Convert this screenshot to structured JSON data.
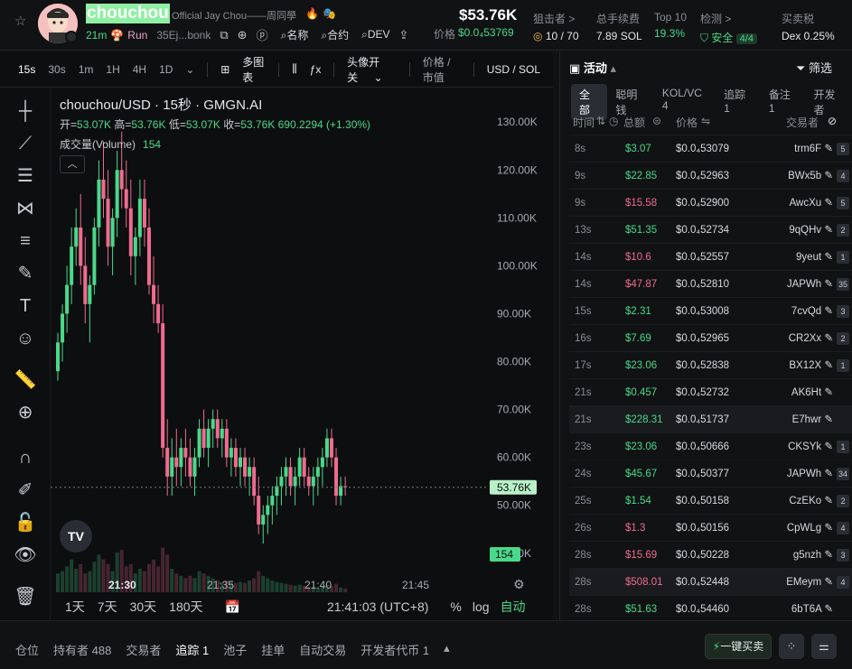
{
  "header": {
    "token_name": "chouchou",
    "token_subtitle": "Official Jay Chou——周同學",
    "age": "21m",
    "run_label": "Run",
    "address": "35Ej...bonk",
    "links": [
      "名称",
      "合约",
      "DEV"
    ],
    "price_big": "$53.76K",
    "price_label": "价格",
    "price_value": "$0.0₄53769",
    "stats": [
      {
        "key": "狙击者 >",
        "value": "10 / 70"
      },
      {
        "key": "总手续费",
        "value": "7.89 SOL"
      },
      {
        "key": "Top 10",
        "value": "19.3%"
      },
      {
        "key": "检测 >",
        "value": "安全",
        "badge": "4/4"
      },
      {
        "key": "买卖税",
        "value": "Dex 0.25%"
      }
    ]
  },
  "toolbar": {
    "intervals": [
      "15s",
      "30s",
      "1m",
      "1H",
      "4H",
      "1D"
    ],
    "multi_chart": "多图表",
    "avatar_toggle": "头像开关",
    "price_mode": "价格 / 市值",
    "currency": "USD / SOL"
  },
  "chart_info": {
    "title": "chouchou/USD · 15秒 · GMGN.AI",
    "open_label": "开=",
    "open": "53.07K",
    "high_label": "高=",
    "high": "53.76K",
    "low_label": "低=",
    "low": "53.07K",
    "close_label": "收=",
    "close": "53.76K",
    "change": "690.2294 (+1.30%)",
    "volume_label": "成交量(Volume)",
    "volume": "154",
    "last_price_tag": "53.76K",
    "volume_tag": "154",
    "tv_logo": "TV"
  },
  "chart_data": {
    "type": "candlestick",
    "y_ticks": [
      "130.00K",
      "120.00K",
      "110.00K",
      "100.00K",
      "90.00K",
      "80.00K",
      "70.00K",
      "60.00K",
      "50.00K",
      "40.00K"
    ],
    "x_ticks": [
      "21:30",
      "21:35",
      "21:40",
      "21:45"
    ],
    "ylim": [
      36000,
      134000
    ],
    "last_price": 53760,
    "candles": [
      [
        78,
        86,
        76,
        84,
        40
      ],
      [
        84,
        92,
        80,
        90,
        45
      ],
      [
        90,
        100,
        86,
        96,
        55
      ],
      [
        96,
        108,
        92,
        104,
        70
      ],
      [
        104,
        112,
        100,
        108,
        50
      ],
      [
        108,
        115,
        96,
        100,
        60
      ],
      [
        100,
        106,
        88,
        92,
        40
      ],
      [
        92,
        98,
        84,
        96,
        45
      ],
      [
        96,
        110,
        94,
        108,
        65
      ],
      [
        108,
        122,
        104,
        118,
        80
      ],
      [
        118,
        126,
        110,
        114,
        70
      ],
      [
        114,
        120,
        100,
        104,
        60
      ],
      [
        104,
        112,
        98,
        110,
        45
      ],
      [
        110,
        124,
        106,
        120,
        85
      ],
      [
        120,
        128,
        112,
        116,
        90
      ],
      [
        116,
        122,
        108,
        112,
        55
      ],
      [
        112,
        118,
        98,
        102,
        60
      ],
      [
        102,
        108,
        96,
        106,
        40
      ],
      [
        106,
        118,
        102,
        114,
        50
      ],
      [
        114,
        118,
        104,
        108,
        45
      ],
      [
        108,
        112,
        94,
        96,
        60
      ],
      [
        96,
        102,
        88,
        92,
        70
      ],
      [
        92,
        96,
        86,
        88,
        55
      ],
      [
        88,
        92,
        60,
        62,
        95
      ],
      [
        62,
        68,
        52,
        56,
        80
      ],
      [
        56,
        64,
        52,
        60,
        50
      ],
      [
        60,
        66,
        54,
        58,
        40
      ],
      [
        58,
        64,
        54,
        62,
        35
      ],
      [
        62,
        66,
        56,
        60,
        30
      ],
      [
        60,
        64,
        54,
        56,
        35
      ],
      [
        56,
        62,
        52,
        60,
        30
      ],
      [
        60,
        68,
        58,
        66,
        45
      ],
      [
        66,
        70,
        60,
        62,
        40
      ],
      [
        62,
        68,
        58,
        66,
        35
      ],
      [
        66,
        70,
        62,
        68,
        30
      ],
      [
        68,
        70,
        62,
        64,
        25
      ],
      [
        64,
        68,
        60,
        66,
        20
      ],
      [
        66,
        68,
        58,
        60,
        25
      ],
      [
        60,
        64,
        56,
        62,
        22
      ],
      [
        62,
        64,
        56,
        58,
        20
      ],
      [
        58,
        62,
        54,
        60,
        22
      ],
      [
        60,
        62,
        54,
        56,
        20
      ],
      [
        56,
        60,
        52,
        58,
        25
      ],
      [
        58,
        60,
        50,
        52,
        30
      ],
      [
        52,
        56,
        44,
        46,
        45
      ],
      [
        46,
        50,
        42,
        48,
        35
      ],
      [
        48,
        52,
        44,
        50,
        30
      ],
      [
        50,
        54,
        46,
        52,
        25
      ],
      [
        52,
        56,
        48,
        54,
        22
      ],
      [
        54,
        58,
        50,
        56,
        20
      ],
      [
        56,
        60,
        52,
        58,
        18
      ],
      [
        58,
        60,
        52,
        54,
        16
      ],
      [
        54,
        58,
        50,
        56,
        14
      ],
      [
        56,
        62,
        54,
        60,
        16
      ],
      [
        60,
        62,
        54,
        56,
        14
      ],
      [
        56,
        58,
        52,
        54,
        12
      ],
      [
        54,
        58,
        50,
        56,
        12
      ],
      [
        56,
        60,
        52,
        58,
        10
      ],
      [
        58,
        62,
        54,
        60,
        12
      ],
      [
        60,
        66,
        58,
        64,
        16
      ],
      [
        64,
        66,
        58,
        60,
        14
      ],
      [
        60,
        62,
        50,
        52,
        18
      ],
      [
        52,
        56,
        50,
        54,
        10
      ],
      [
        54,
        56,
        52,
        53.8,
        8
      ]
    ],
    "grid": false
  },
  "chart_bottom": {
    "ranges": [
      "1天",
      "7天",
      "30天",
      "180天"
    ],
    "time": "21:41:03 (UTC+8)",
    "pct": "%",
    "log": "log",
    "auto": "自动"
  },
  "activity": {
    "title": "活动",
    "filter": "筛选",
    "tabs": [
      "全部",
      "聪明钱",
      "KOL/VC 4",
      "追踪 1",
      "备注 1",
      "开发者"
    ],
    "columns": [
      "时间",
      "总额",
      "价格",
      "交易者"
    ],
    "rows": [
      {
        "age": "8s",
        "total": "$3.07",
        "side": "buy",
        "price": "$0.0₄53079",
        "trader": "trm6F",
        "count": "5"
      },
      {
        "age": "9s",
        "total": "$22.85",
        "side": "buy",
        "price": "$0.0₄52963",
        "trader": "BWx5b",
        "count": "4"
      },
      {
        "age": "9s",
        "total": "$15.58",
        "side": "sell",
        "price": "$0.0₄52900",
        "trader": "AwcXu",
        "count": "5"
      },
      {
        "age": "13s",
        "total": "$51.35",
        "side": "buy",
        "price": "$0.0₄52734",
        "trader": "9qQHv",
        "count": "2"
      },
      {
        "age": "14s",
        "total": "$10.6",
        "side": "sell",
        "price": "$0.0₄52557",
        "trader": "9yeut",
        "count": "1"
      },
      {
        "age": "14s",
        "total": "$47.87",
        "side": "sell",
        "price": "$0.0₄52810",
        "trader": "JAPWh",
        "count": "35"
      },
      {
        "age": "15s",
        "total": "$2.31",
        "side": "buy",
        "price": "$0.0₄53008",
        "trader": "7cvQd",
        "count": "3"
      },
      {
        "age": "16s",
        "total": "$7.69",
        "side": "buy",
        "price": "$0.0₄52965",
        "trader": "CR2Xx",
        "count": "2"
      },
      {
        "age": "17s",
        "total": "$23.06",
        "side": "buy",
        "price": "$0.0₄52838",
        "trader": "BX12X",
        "count": "1"
      },
      {
        "age": "21s",
        "total": "$0.457",
        "side": "buy",
        "price": "$0.0₄52732",
        "trader": "AK6Ht",
        "count": ""
      },
      {
        "age": "21s",
        "total": "$228.31",
        "side": "buy",
        "price": "$0.0₄51737",
        "trader": "E7hwr",
        "count": ""
      },
      {
        "age": "23s",
        "total": "$23.06",
        "side": "buy",
        "price": "$0.0₄50666",
        "trader": "CKSYk",
        "count": "1"
      },
      {
        "age": "24s",
        "total": "$45.67",
        "side": "buy",
        "price": "$0.0₄50377",
        "trader": "JAPWh",
        "count": "34"
      },
      {
        "age": "25s",
        "total": "$1.54",
        "side": "buy",
        "price": "$0.0₄50158",
        "trader": "CzEKo",
        "count": "2"
      },
      {
        "age": "26s",
        "total": "$1.3",
        "side": "sell",
        "price": "$0.0₄50156",
        "trader": "CpWLg",
        "count": "4"
      },
      {
        "age": "28s",
        "total": "$15.69",
        "side": "sell",
        "price": "$0.0₄50228",
        "trader": "g5nzh",
        "count": "3"
      },
      {
        "age": "28s",
        "total": "$508.01",
        "side": "sell",
        "price": "$0.0₄52448",
        "trader": "EMeym",
        "count": "4"
      },
      {
        "age": "28s",
        "total": "$51.63",
        "side": "buy",
        "price": "$0.0₄54460",
        "trader": "6bT6A",
        "count": ""
      }
    ]
  },
  "footer": {
    "tabs": [
      "仓位",
      "持有者 488",
      "交易者",
      "追踪 1",
      "池子",
      "挂单",
      "自动交易",
      "开发者代币 1"
    ],
    "quick_buy": "一键买卖"
  },
  "colors": {
    "up": "#49d98a",
    "down": "#f06b8f",
    "bg": "#0d0e10"
  }
}
